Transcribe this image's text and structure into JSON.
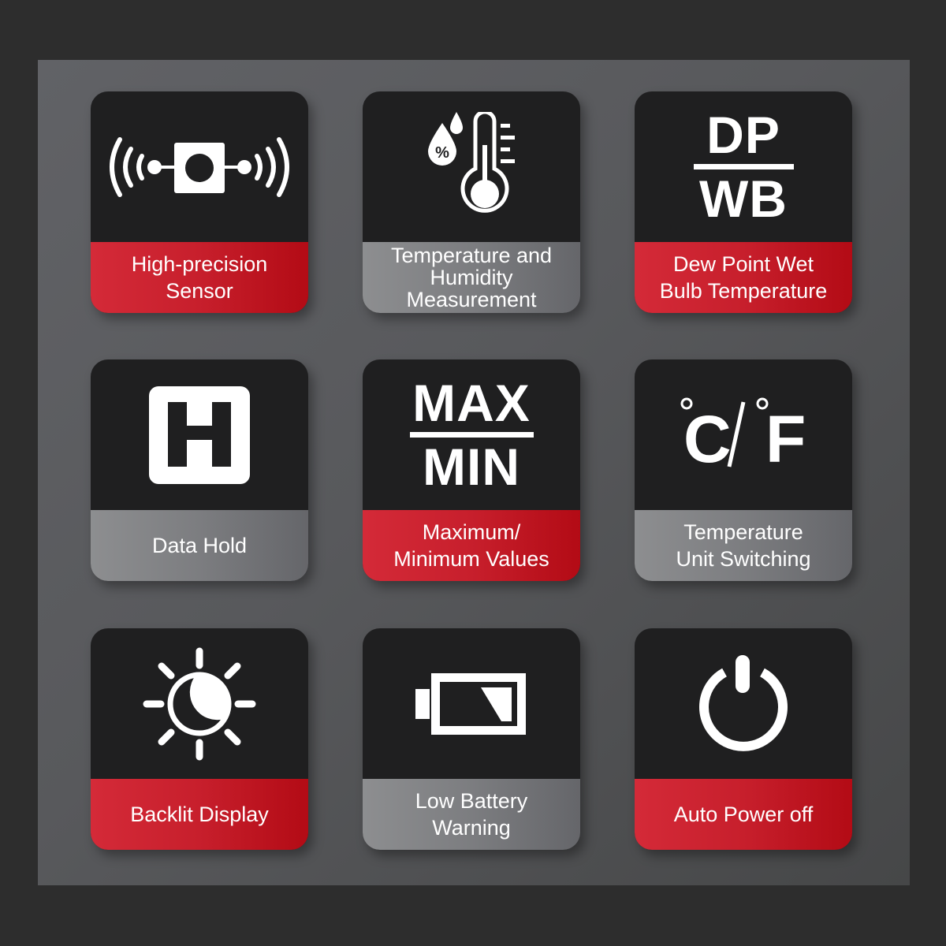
{
  "features": [
    {
      "id": "sensor",
      "label": "High-precision\nSensor",
      "icon": "sensor-signal-icon",
      "style": "red"
    },
    {
      "id": "temp-humidity",
      "label": "Temperature and\nHumidity\nMeasurement",
      "icon": "thermometer-humidity-icon",
      "style": "gray"
    },
    {
      "id": "dew-point",
      "label": "Dew Point Wet\nBulb Temperature",
      "icon": "dp-wb-icon",
      "icon_text_top": "DP",
      "icon_text_bottom": "WB",
      "style": "red"
    },
    {
      "id": "data-hold",
      "label": "Data Hold",
      "icon": "hold-h-icon",
      "icon_text": "H",
      "style": "gray"
    },
    {
      "id": "max-min",
      "label": "Maximum/\nMinimum Values",
      "icon": "max-min-icon",
      "icon_text_top": "MAX",
      "icon_text_bottom": "MIN",
      "style": "red"
    },
    {
      "id": "unit-switch",
      "label": "Temperature\nUnit Switching",
      "icon": "celsius-fahrenheit-icon",
      "icon_text": "°C/°F",
      "style": "gray"
    },
    {
      "id": "backlight",
      "label": "Backlit Display",
      "icon": "sun-moon-icon",
      "style": "red"
    },
    {
      "id": "low-battery",
      "label": "Low Battery\nWarning",
      "icon": "low-battery-icon",
      "style": "gray"
    },
    {
      "id": "auto-power-off",
      "label": "Auto Power off",
      "icon": "power-icon",
      "style": "red"
    }
  ],
  "colors": {
    "outer_background": "#2d2d2d",
    "panel": "#58595c",
    "tile_top": "#1f1f20",
    "label_red": "#c71f2c",
    "label_gray": "#7c7d80",
    "text": "#ffffff"
  }
}
